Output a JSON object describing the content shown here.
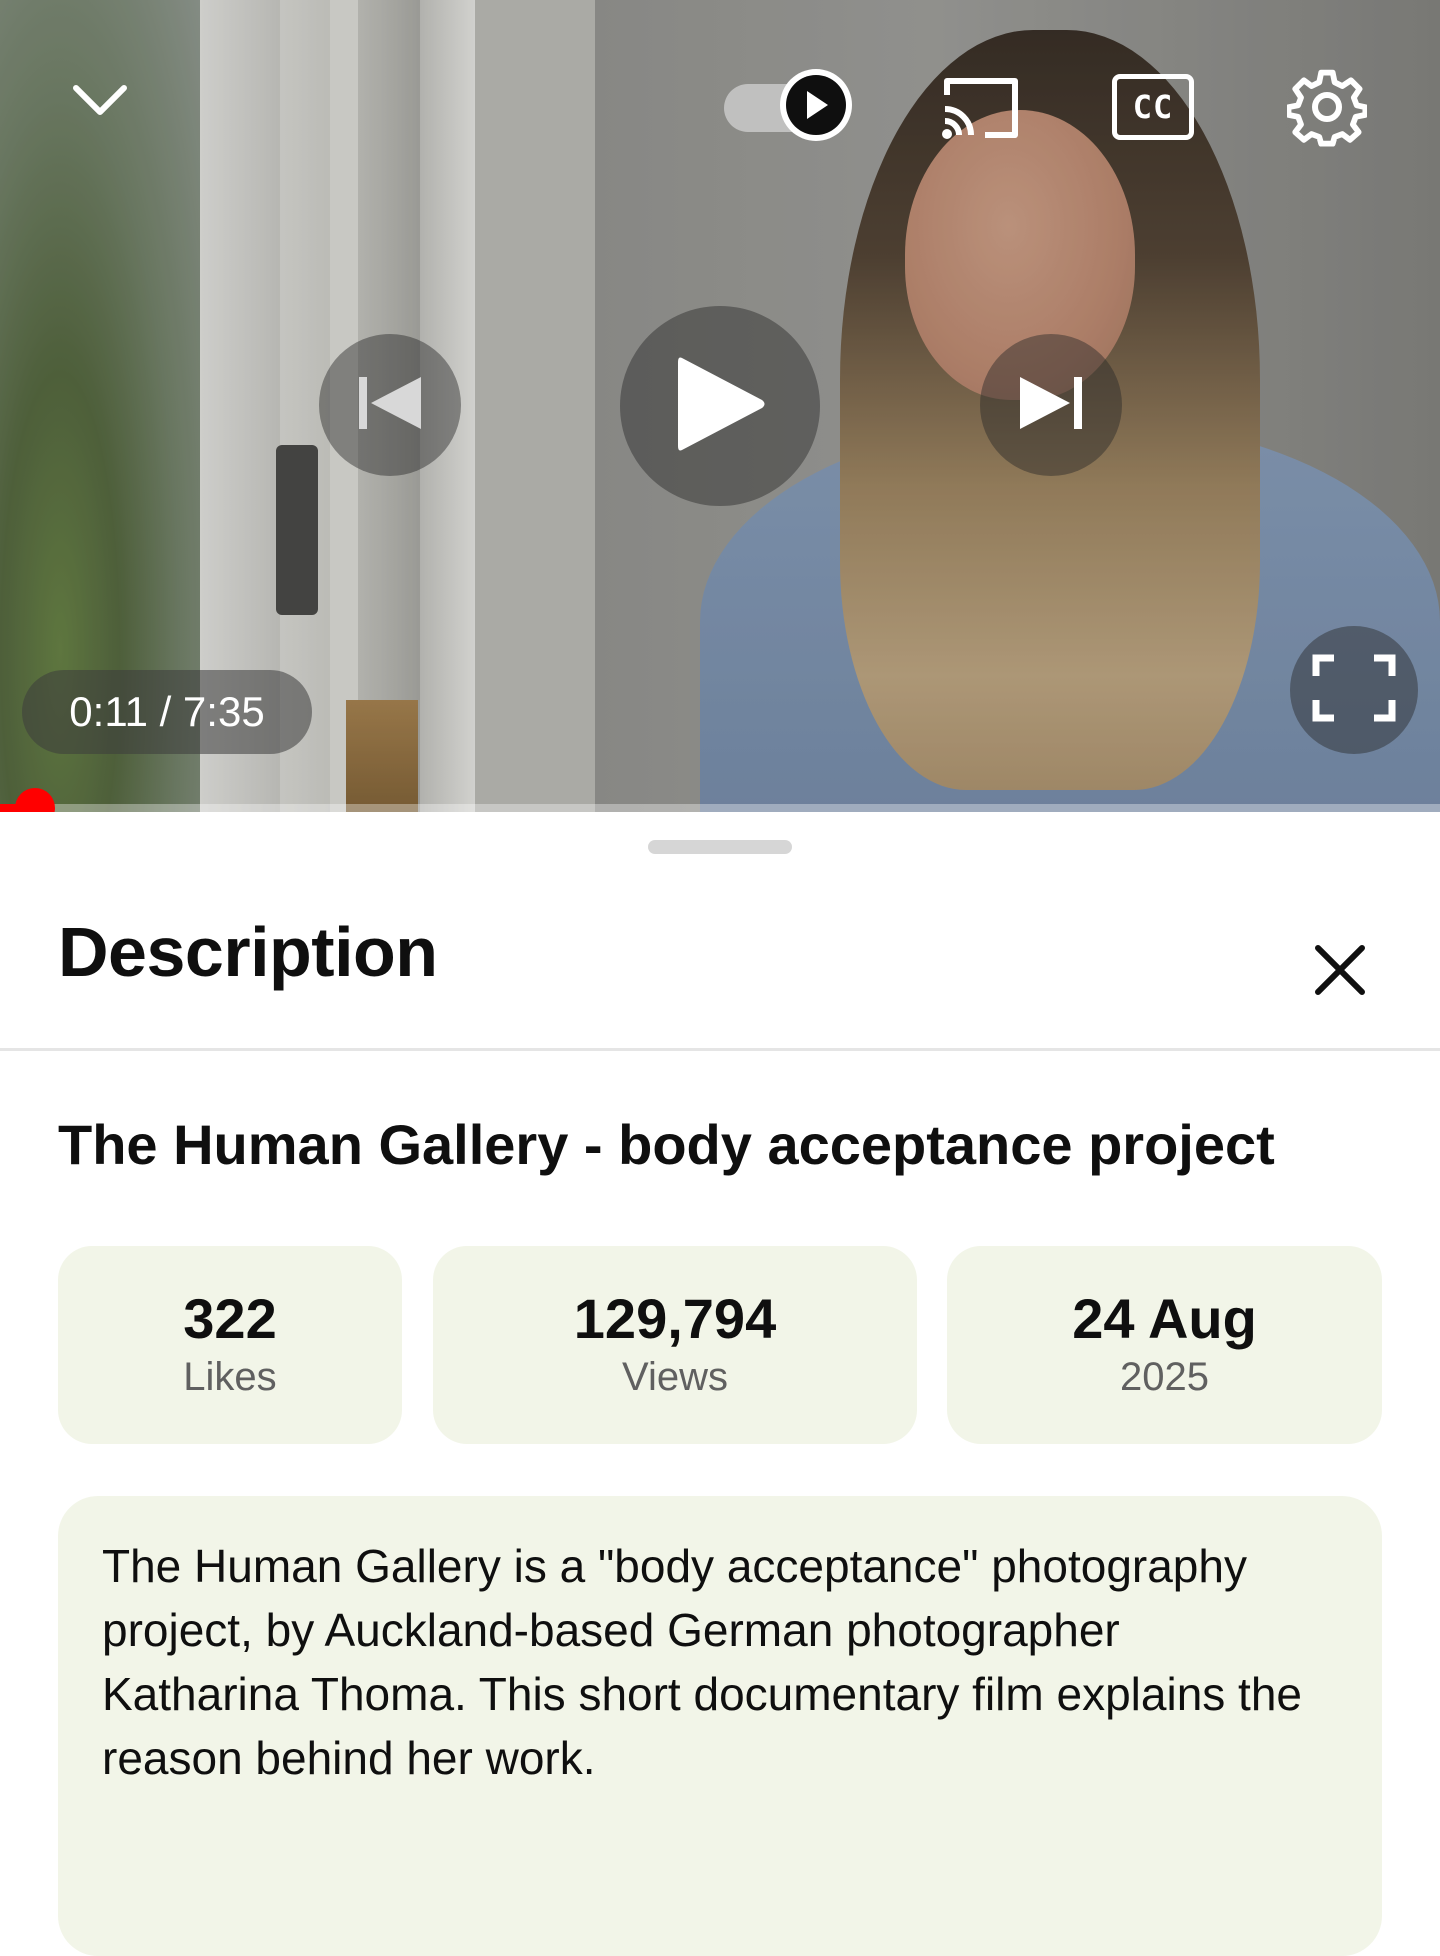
{
  "player": {
    "icons": {
      "minimize": "chevron-down-icon",
      "autoplay": "autoplay-toggle-icon",
      "cast": "cast-icon",
      "captions": "captions-icon",
      "settings": "gear-icon",
      "previous": "previous-icon",
      "play": "play-icon",
      "next": "next-icon",
      "fullscreen": "fullscreen-icon"
    },
    "time_display": "0:11 / 7:35",
    "captions_label": "CC",
    "progress_fraction": 0.024,
    "accent_color": "#ff0000"
  },
  "sheet": {
    "title": "Description",
    "close_icon": "close-icon"
  },
  "video": {
    "title": "The Human Gallery - body acceptance project",
    "stats": [
      {
        "value": "322",
        "label": "Likes"
      },
      {
        "value": "129,794",
        "label": "Views"
      },
      {
        "value": "24 Aug",
        "label": "2025"
      }
    ],
    "description": "The Human Gallery is a \"body acceptance\" photography project, by Auckland-based German photographer Katharina Thoma. This short documentary film explains the reason behind her work."
  },
  "colors": {
    "stat_background": "#f2f5e8",
    "text_primary": "#0f0f0f",
    "text_secondary": "#606060"
  }
}
